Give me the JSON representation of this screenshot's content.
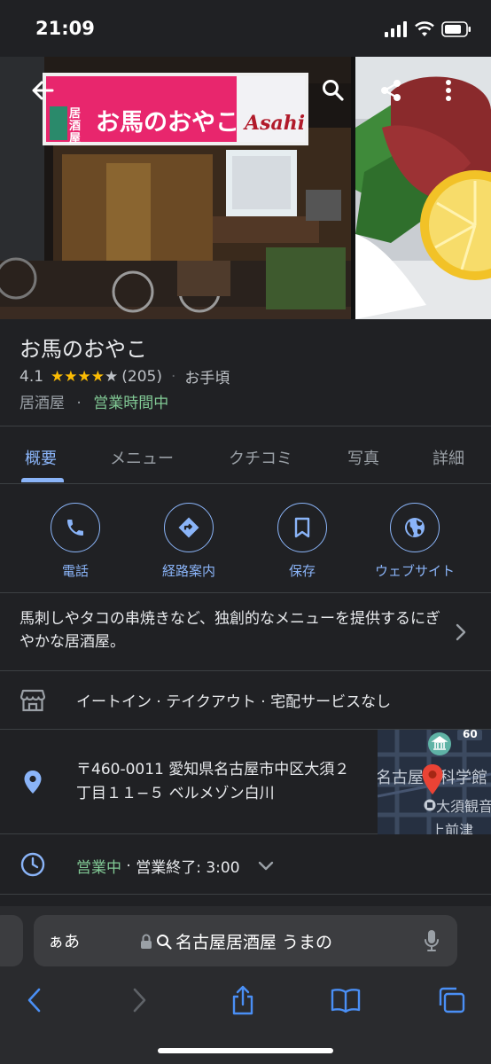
{
  "status_bar": {
    "time": "21:09"
  },
  "photo_sign": {
    "shop_type": "居酒屋",
    "shop_name": "お馬のおやこ",
    "beer_brand": "Asahi"
  },
  "place": {
    "name": "お馬のおやこ",
    "rating": "4.1",
    "stars": 4.1,
    "review_count": "(205)",
    "price": "お手頃",
    "category": "居酒屋",
    "status": "営業時間中"
  },
  "tabs": [
    {
      "label": "概要"
    },
    {
      "label": "メニュー"
    },
    {
      "label": "クチコミ"
    },
    {
      "label": "写真"
    },
    {
      "label": "詳細"
    }
  ],
  "actions": [
    {
      "label": "電話",
      "icon": "phone-icon"
    },
    {
      "label": "経路案内",
      "icon": "directions-icon"
    },
    {
      "label": "保存",
      "icon": "bookmark-icon"
    },
    {
      "label": "ウェブサイト",
      "icon": "globe-icon"
    }
  ],
  "description": "馬刺しやタコの串焼きなど、独創的なメニューを提供するにぎやかな居酒屋。",
  "services": "イートイン · テイクアウト · 宅配サービスなし",
  "address": "〒460-0011 愛知県名古屋市中区大須２丁目１１−５ ベルメゾン白川",
  "map": {
    "labels": [
      "名古屋市科学館",
      "大須観音",
      "上前津"
    ],
    "road_number": "60"
  },
  "hours": {
    "status": "営業中",
    "separator": " · ",
    "closing": "営業終了: 3:00"
  },
  "browser": {
    "aa": "ぁあ",
    "url": "名古屋居酒屋 うまの"
  },
  "colors": {
    "accent": "#8ab4f8",
    "open": "#81c995",
    "star": "#fbbc04",
    "background": "#202124"
  }
}
